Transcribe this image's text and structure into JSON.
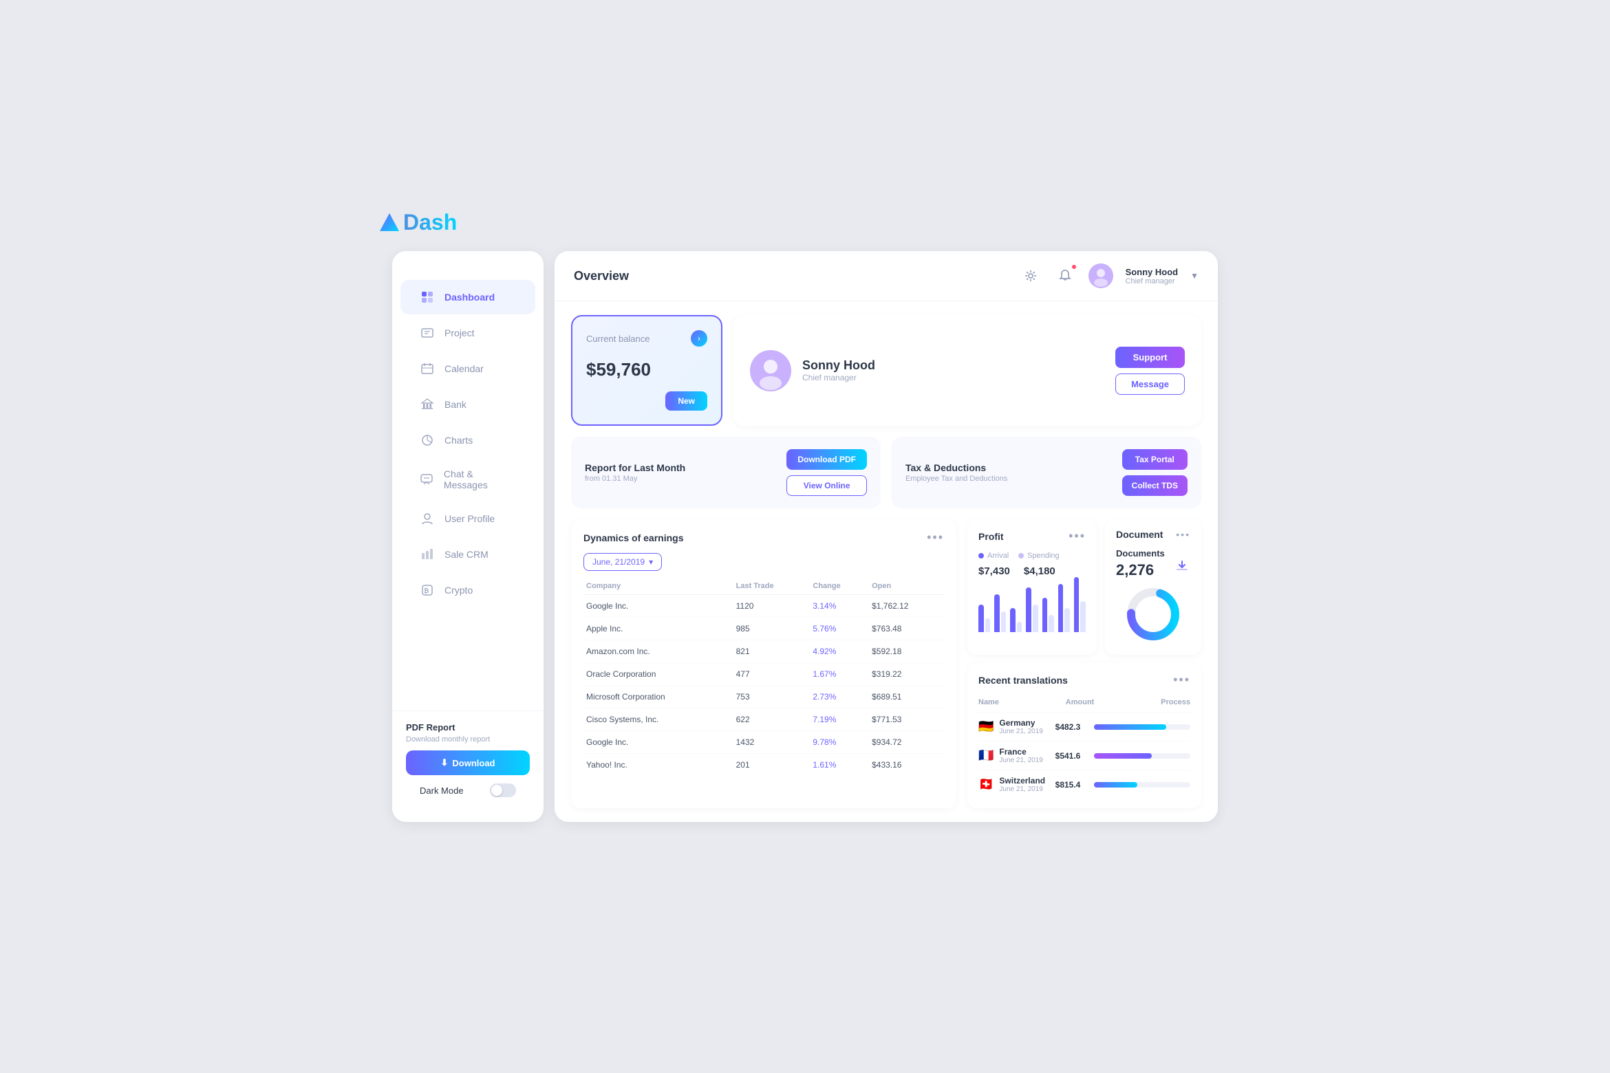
{
  "logo": {
    "text": "Dash"
  },
  "sidebar": {
    "items": [
      {
        "id": "dashboard",
        "label": "Dashboard",
        "active": true
      },
      {
        "id": "project",
        "label": "Project",
        "active": false
      },
      {
        "id": "calendar",
        "label": "Calendar",
        "active": false
      },
      {
        "id": "bank",
        "label": "Bank",
        "active": false
      },
      {
        "id": "charts",
        "label": "Charts",
        "active": false
      },
      {
        "id": "chat",
        "label": "Chat & Messages",
        "active": false
      },
      {
        "id": "user-profile",
        "label": "User Profile",
        "active": false
      },
      {
        "id": "sale-crm",
        "label": "Sale CRM",
        "active": false
      },
      {
        "id": "crypto",
        "label": "Crypto",
        "active": false
      }
    ],
    "pdf_report": {
      "title": "PDF Report",
      "subtitle": "Download monthly report",
      "download_label": "Download"
    },
    "dark_mode_label": "Dark Mode"
  },
  "header": {
    "title": "Overview",
    "user": {
      "name": "Sonny Hood",
      "role": "Chief manager"
    }
  },
  "balance_card": {
    "title": "Current balance",
    "amount": "$59,760",
    "new_btn": "New"
  },
  "user_profile_card": {
    "name": "Sonny Hood",
    "role": "Chief manager",
    "support_btn": "Support",
    "message_btn": "Message"
  },
  "report_card": {
    "title": "Report for Last Month",
    "subtitle": "from 01.31 May",
    "download_pdf_btn": "Download PDF",
    "view_online_btn": "View Online"
  },
  "tax_card": {
    "title": "Tax & Deductions",
    "subtitle": "Employee Tax and Deductions",
    "tax_portal_btn": "Tax Portal",
    "collect_tds_btn": "Collect TDS"
  },
  "earnings_table": {
    "title": "Dynamics of earnings",
    "date_filter": "June, 21/2019",
    "columns": [
      "Company",
      "Last Trade",
      "Change",
      "Open"
    ],
    "rows": [
      {
        "company": "Google Inc.",
        "last_trade": "1120",
        "change": "3.14%",
        "open": "$1,762.12"
      },
      {
        "company": "Apple Inc.",
        "last_trade": "985",
        "change": "5.76%",
        "open": "$763.48"
      },
      {
        "company": "Amazon.com Inc.",
        "last_trade": "821",
        "change": "4.92%",
        "open": "$592.18"
      },
      {
        "company": "Oracle Corporation",
        "last_trade": "477",
        "change": "1.67%",
        "open": "$319.22"
      },
      {
        "company": "Microsoft Corporation",
        "last_trade": "753",
        "change": "2.73%",
        "open": "$689.51"
      },
      {
        "company": "Cisco Systems, Inc.",
        "last_trade": "622",
        "change": "7.19%",
        "open": "$771.53"
      },
      {
        "company": "Google Inc.",
        "last_trade": "1432",
        "change": "9.78%",
        "open": "$934.72"
      },
      {
        "company": "Yahoo! Inc.",
        "last_trade": "201",
        "change": "1.61%",
        "open": "$433.16"
      }
    ]
  },
  "profit_card": {
    "title": "Profit",
    "arrival_label": "Arrival",
    "spending_label": "Spending",
    "arrival_value": "$7,430",
    "spending_value": "$4,180",
    "bars": [
      {
        "arrival": 40,
        "spending": 20
      },
      {
        "arrival": 55,
        "spending": 30
      },
      {
        "arrival": 35,
        "spending": 15
      },
      {
        "arrival": 65,
        "spending": 40
      },
      {
        "arrival": 50,
        "spending": 25
      },
      {
        "arrival": 70,
        "spending": 35
      },
      {
        "arrival": 80,
        "spending": 45
      }
    ]
  },
  "document_card": {
    "title": "Document",
    "docs_label": "Documents",
    "docs_count": "2,276",
    "donut_filled": 70,
    "donut_empty": 30
  },
  "translations_card": {
    "title": "Recent translations",
    "columns": [
      "Name",
      "Amount",
      "Process"
    ],
    "rows": [
      {
        "country": "Germany",
        "flag": "🇩🇪",
        "date": "June 21, 2019",
        "amount": "$482.3",
        "progress": 75
      },
      {
        "country": "France",
        "flag": "🇫🇷",
        "date": "June 21, 2019",
        "amount": "$541.6",
        "progress": 60
      },
      {
        "country": "Switzerland",
        "flag": "🇨🇭",
        "date": "June 21, 2019",
        "amount": "$815.4",
        "progress": 45
      }
    ]
  }
}
